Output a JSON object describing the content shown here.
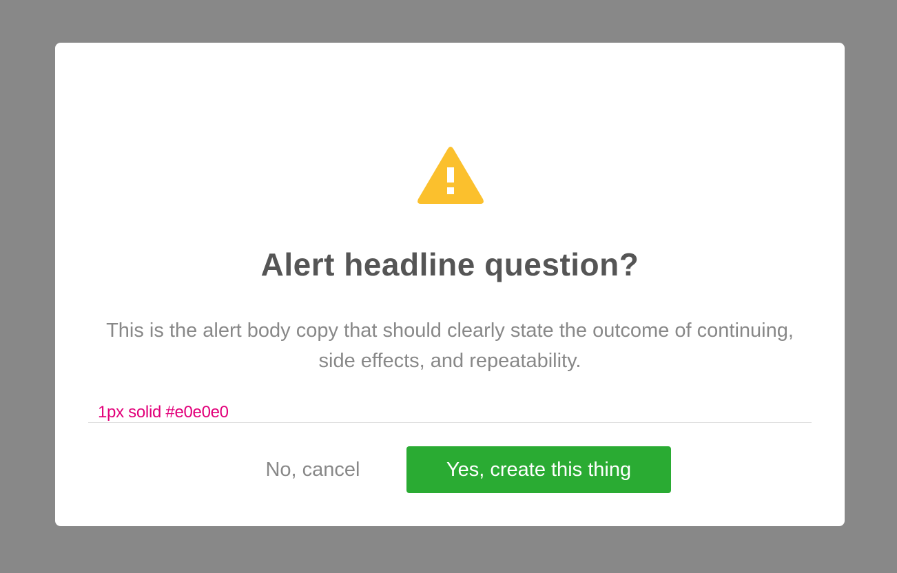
{
  "colors": {
    "backdrop": "#888888",
    "dialog_background": "#ffffff",
    "warning_icon": "#fbc02d",
    "headline_text": "#555555",
    "body_text": "#888888",
    "annotation_text": "#e2007a",
    "divider": "#e0e0e0",
    "confirm_button_background": "#2aab33",
    "confirm_button_text": "#ffffff",
    "cancel_button_text": "#888888"
  },
  "dialog": {
    "icon": "warning-icon",
    "headline": "Alert headline question?",
    "body": "This is the alert body copy that should clearly state the outcome of continuing, side effects, and repeatability.",
    "divider_annotation": "1px solid #e0e0e0",
    "actions": {
      "cancel_label": "No, cancel",
      "confirm_label": "Yes, create this thing"
    }
  }
}
